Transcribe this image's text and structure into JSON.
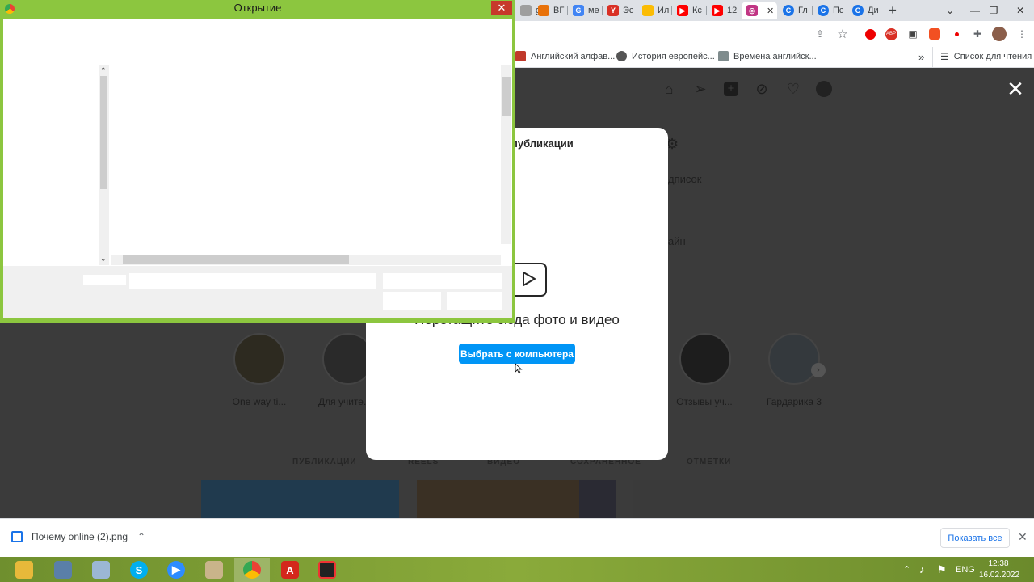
{
  "browser": {
    "tabs": [
      {
        "label": "gr",
        "color": "#9e9e9e"
      },
      {
        "label": "ВГ",
        "color": "#e8710a"
      },
      {
        "label": "ме",
        "color": "#4285f4"
      },
      {
        "label": "Эс",
        "color": "#d93025"
      },
      {
        "label": "Ил",
        "color": "#fbbc04"
      },
      {
        "label": "Кс",
        "color": "#ff0000"
      },
      {
        "label": "12",
        "color": "#ff0000"
      },
      {
        "label": "",
        "color": "#c13584"
      },
      {
        "label": "Гл",
        "color": "#1a73e8"
      },
      {
        "label": "Пс",
        "color": "#1a73e8"
      },
      {
        "label": "Ди",
        "color": "#1a73e8"
      }
    ],
    "new_tab": "+",
    "bookmarks": [
      {
        "label": "Английский алфав...",
        "color": "#c0392b"
      },
      {
        "label": "История европейс...",
        "color": "#555555"
      },
      {
        "label": "Времена английск...",
        "color": "#7f8c8d"
      }
    ],
    "bookmarks_more": "»",
    "reading_list": "Список для чтения"
  },
  "dialog": {
    "title": "Открытие",
    "close": "✕"
  },
  "instagram": {
    "modal_title": "публикации",
    "drop_text": "Перетащите сюда фото и видео",
    "choose_button": "Выбрать с компьютера",
    "profile_text_1": "дписок",
    "profile_text_2": "айн",
    "highlights": [
      {
        "label": "One way ti..."
      },
      {
        "label": "Для учите..."
      },
      {
        "label": "Отзывы уч..."
      },
      {
        "label": "Гардарика 3"
      }
    ],
    "profile_tabs": [
      "ПУБЛИКАЦИИ",
      "REELS",
      "ВИДЕО",
      "СОХРАНЕННОЕ",
      "ОТМЕТКИ"
    ],
    "overlay_close": "✕"
  },
  "downloads": {
    "file_name": "Почему online (2).png",
    "show_all": "Показать все",
    "close": "✕"
  },
  "taskbar": {
    "language": "ENG",
    "time": "12:38",
    "date": "16.02.2022"
  }
}
